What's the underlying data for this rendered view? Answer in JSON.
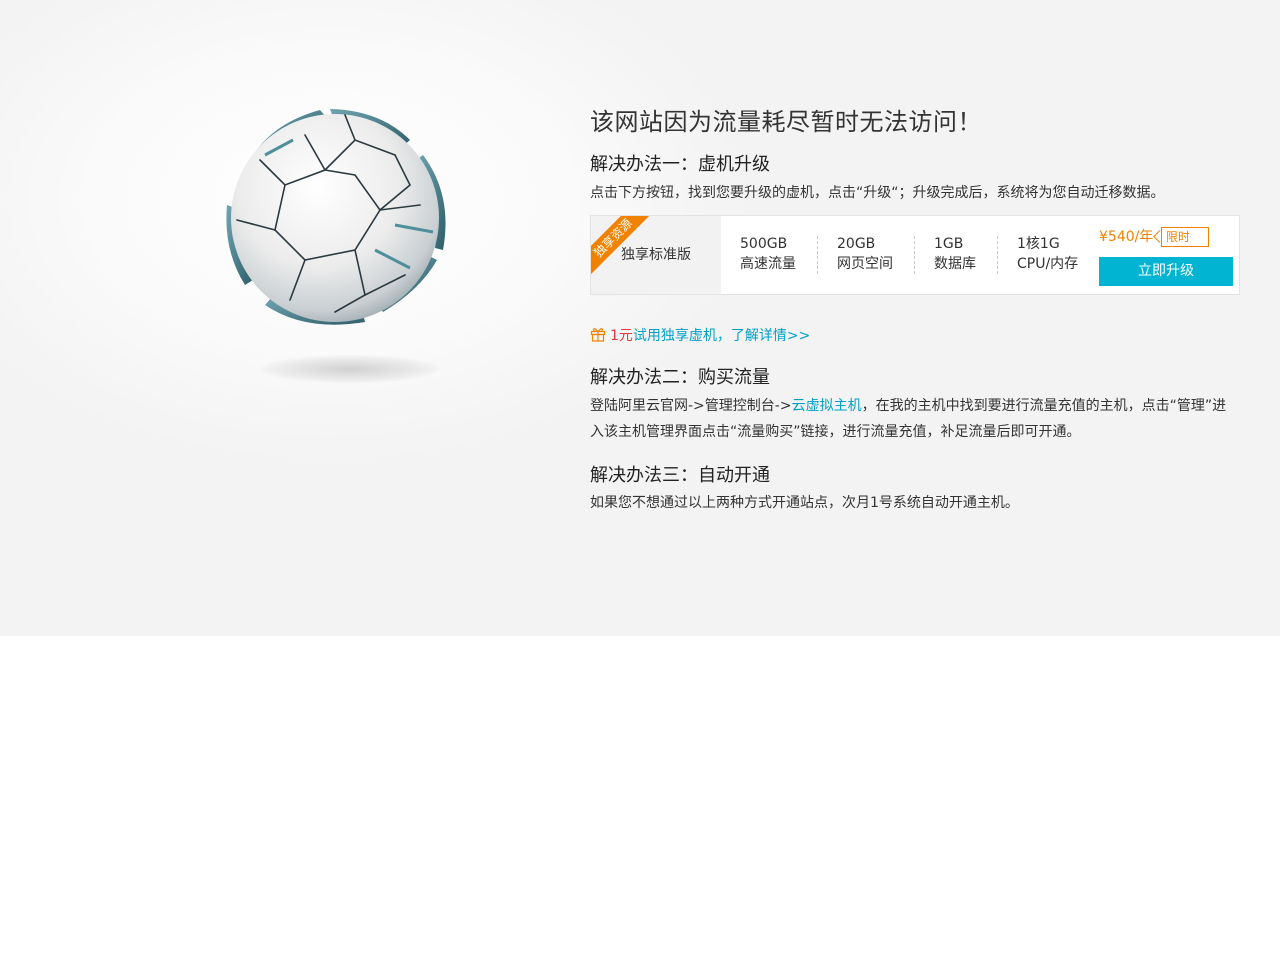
{
  "main_title": "该网站因为流量耗尽暂时无法访问！",
  "solution1": {
    "title": "解决办法一：虚机升级",
    "desc": "点击下方按钮，找到您要升级的虚机，点击“升级“；升级完成后，系统将为您自动迁移数据。"
  },
  "plan": {
    "ribbon": "独享资源",
    "name": "独享标准版",
    "specs": [
      {
        "value": "500GB",
        "label": "高速流量"
      },
      {
        "value": "20GB",
        "label": "网页空间"
      },
      {
        "value": "1GB",
        "label": "数据库"
      },
      {
        "value": "1核1G",
        "label": "CPU/内存"
      }
    ],
    "price": "¥540/年",
    "tag": "限时",
    "button": "立即升级"
  },
  "trial": {
    "price": "1元",
    "link_text": "试用独享虚机，了解详情>>"
  },
  "solution2": {
    "title": "解决办法二：购买流量",
    "desc_before": "登陆阿里云官网->管理控制台->",
    "link_text": "云虚拟主机",
    "desc_after": "，在我的主机中找到要进行流量充值的主机，点击“管理”进入该主机管理界面点击“流量购买”链接，进行流量充值，补足流量后即可开通。"
  },
  "solution3": {
    "title": "解决办法三：自动开通",
    "desc": "如果您不想通过以上两种方式开通站点，次月1号系统自动开通主机。"
  },
  "colors": {
    "accent": "#00b4d2",
    "link": "#00a0c8",
    "orange": "#f08200",
    "red": "#e4393c"
  }
}
